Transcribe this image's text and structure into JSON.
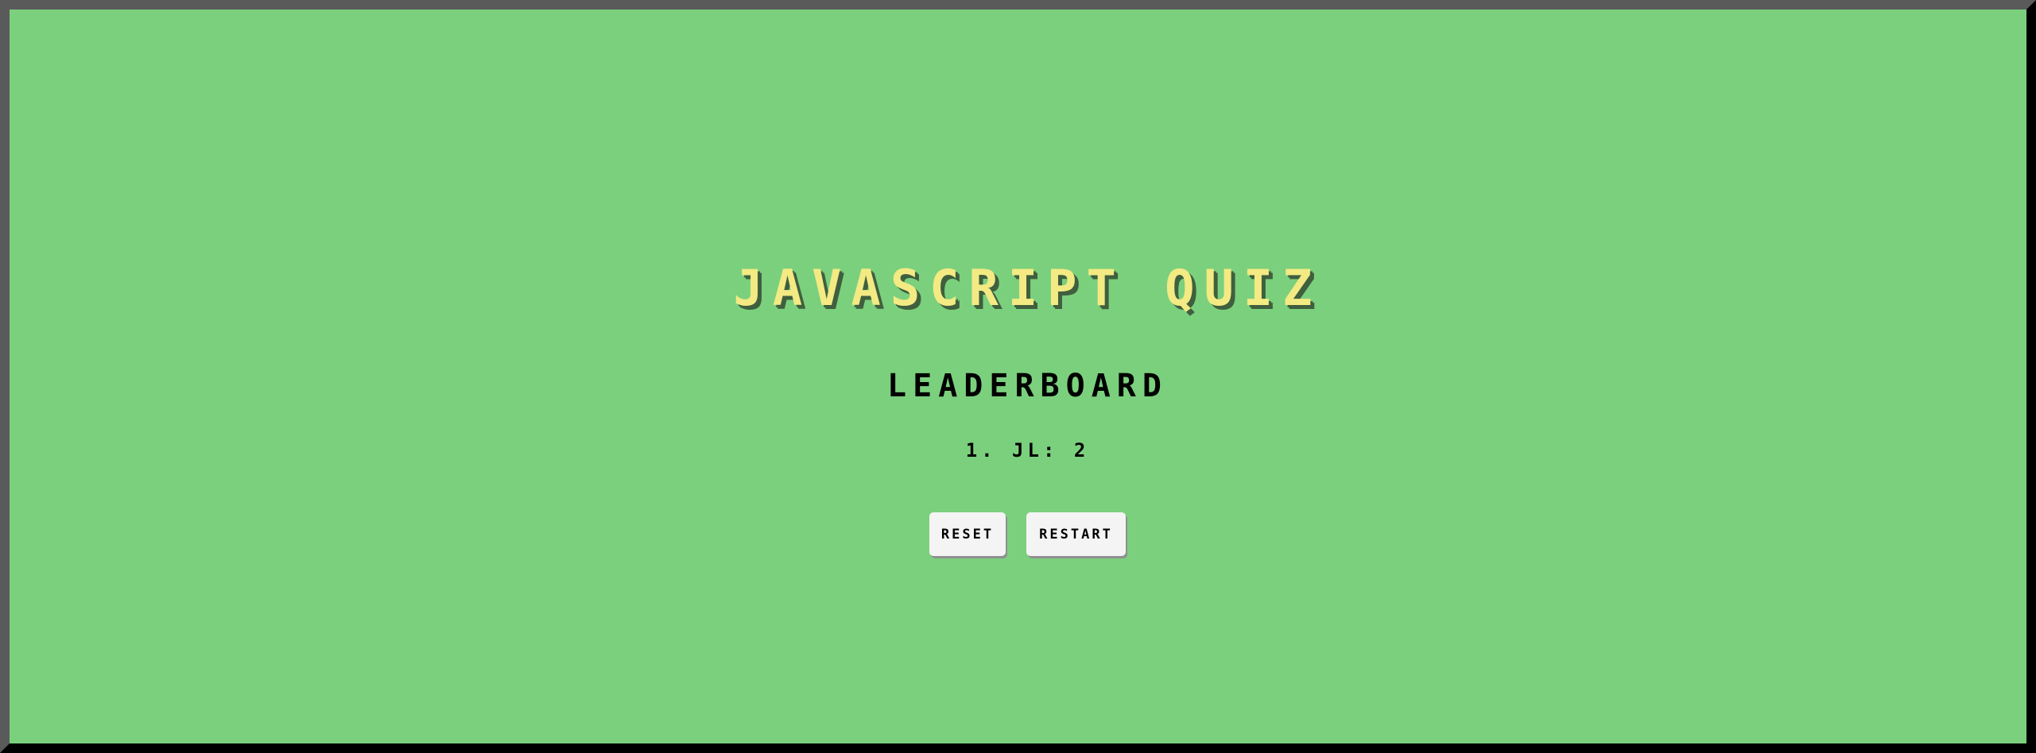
{
  "title": "JAVASCRIPT QUIZ",
  "leaderboard": {
    "heading": "LEADERBOARD",
    "entries": [
      "1. JL: 2"
    ]
  },
  "buttons": {
    "reset_label": "RESET",
    "restart_label": "RESTART"
  },
  "colors": {
    "background": "#7bd07d",
    "title": "#f3ea83",
    "text": "#000000",
    "button": "#f4f4f4"
  }
}
